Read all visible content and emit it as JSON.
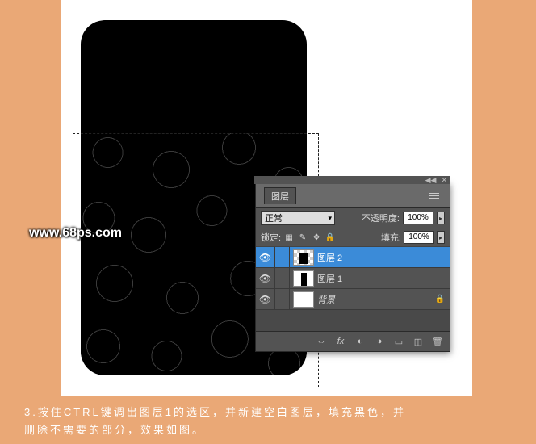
{
  "watermark": "www.68ps.com",
  "panel": {
    "tab": "图层",
    "blend_label": "正常",
    "opacity_label": "不透明度:",
    "opacity_value": "100%",
    "lock_label": "锁定:",
    "fill_label": "填充:",
    "fill_value": "100%",
    "layers": [
      {
        "name": "图层 2"
      },
      {
        "name": "图层 1"
      },
      {
        "name": "背景"
      }
    ]
  },
  "caption_line1": "3.按住CTRL键调出图层1的选区，并新建空白图层，填充黑色，并",
  "caption_line2": "删除不需要的部分，效果如图。"
}
